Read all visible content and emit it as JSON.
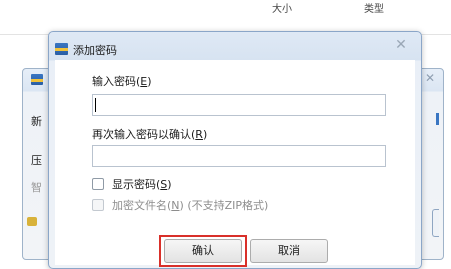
{
  "explorer": {
    "col_type": "大小",
    "col_modified": "类型"
  },
  "parent": {
    "label_a": "新",
    "label_b": "压",
    "label_c": "智"
  },
  "dialog": {
    "title": "添加密码",
    "label_password": "输入密码(",
    "label_password_key": "E",
    "label_confirm": "再次输入密码以确认(",
    "label_confirm_key": "R",
    "password_value": "",
    "confirm_value": "",
    "show_password": "显示密码(",
    "show_password_key": "S",
    "encrypt_names": "加密文件名(",
    "encrypt_names_key": "N",
    "encrypt_names_note": ") (不支持ZIP格式)",
    "ok": "确认",
    "cancel": "取消"
  },
  "colors": {
    "highlight": "#d9302a",
    "accent": "#3a76c2"
  }
}
